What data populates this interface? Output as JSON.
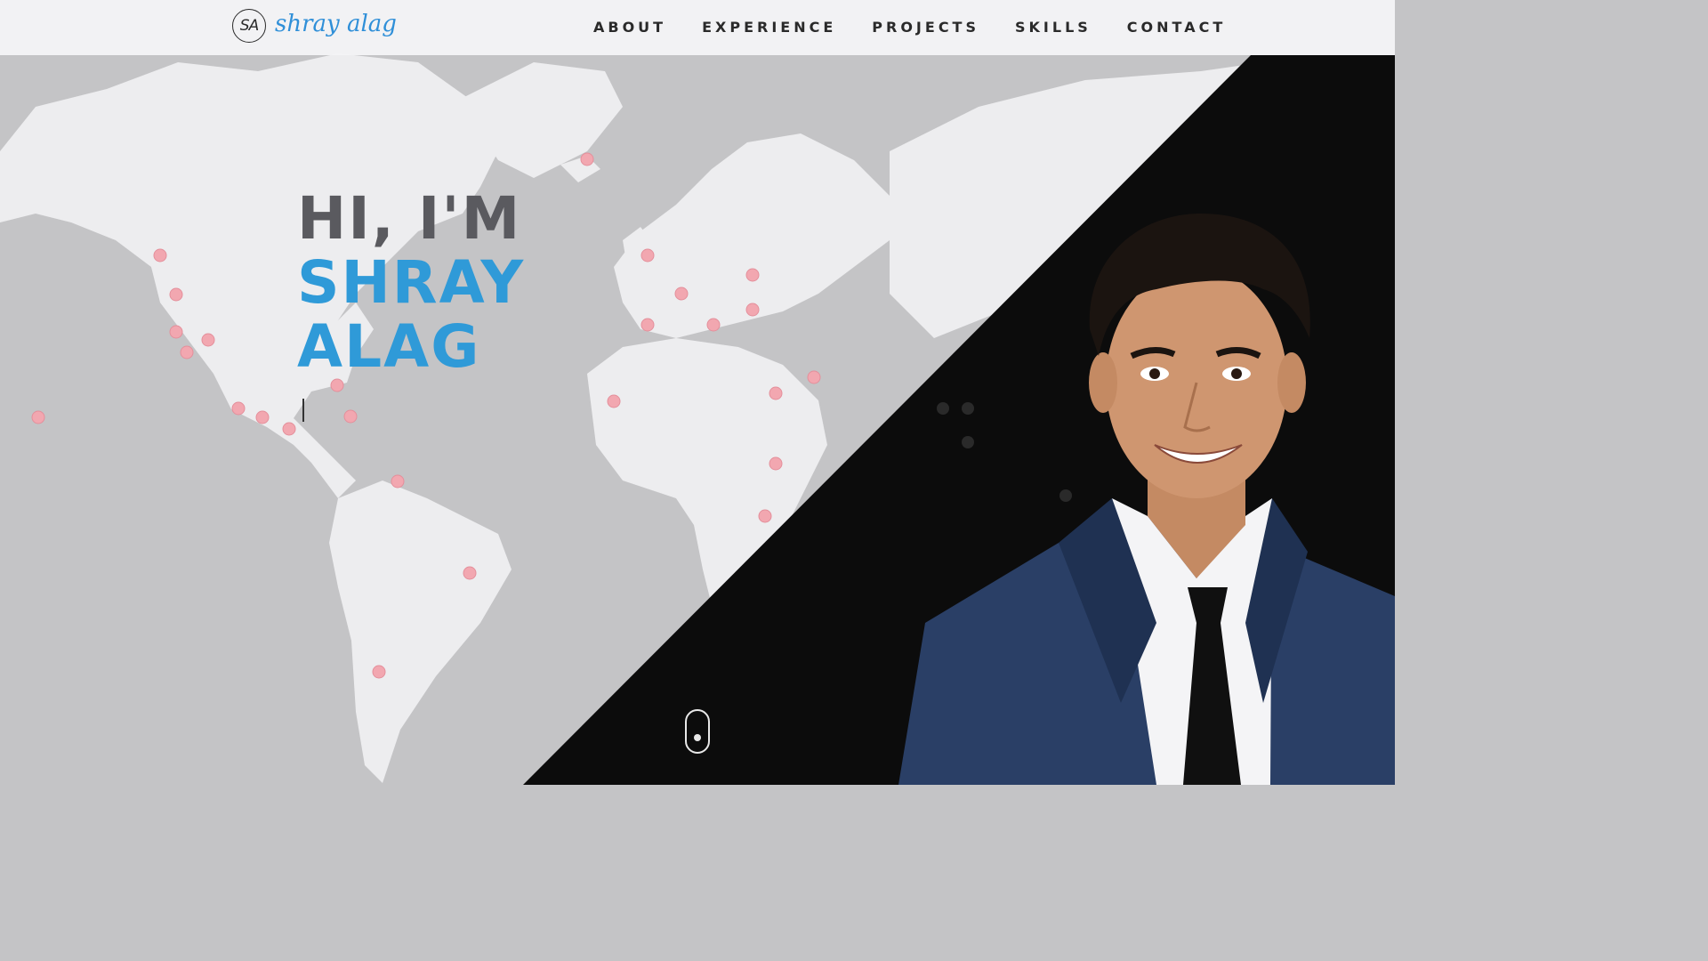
{
  "header": {
    "logo_mark": "SA",
    "logo_text": "shray alag",
    "nav": [
      "ABOUT",
      "EXPERIENCE",
      "PROJECTS",
      "SKILLS",
      "CONTACT"
    ]
  },
  "hero": {
    "line1": "HI, I'M",
    "line2": "SHRAY",
    "line3": "ALAG"
  },
  "colors": {
    "accent": "#2f9ad8",
    "map_bg": "#c4c4c6",
    "land": "#ededef",
    "dark_panel": "#0c0c0c",
    "pin": "#f2a7b0",
    "suit": "#2a3f66"
  },
  "icons": [
    "map-pin-icon",
    "mouse-scroll-icon"
  ]
}
